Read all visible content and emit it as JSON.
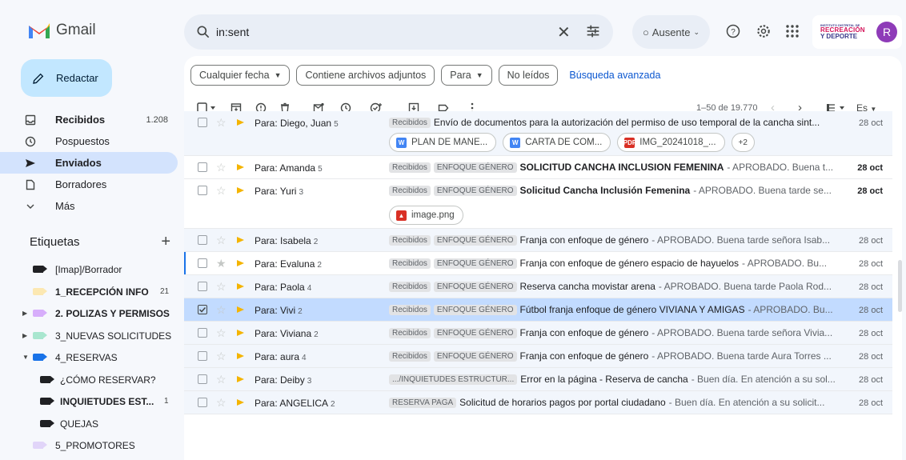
{
  "app": {
    "name": "Gmail"
  },
  "search": {
    "value": "in:sent",
    "clear_label": "✕"
  },
  "header": {
    "status_label": "Ausente",
    "org": {
      "line1": "INSTITUTO DISTRITAL DE",
      "line2": "RECREACIÓN",
      "line3": "Y DEPORTE"
    },
    "avatar_letter": "R"
  },
  "compose_label": "Redactar",
  "nav": [
    {
      "label": "Recibidos",
      "count": "1.208",
      "bold": true,
      "icon": "inbox-icon"
    },
    {
      "label": "Pospuestos",
      "count": "",
      "bold": false,
      "icon": "snooze-icon"
    },
    {
      "label": "Enviados",
      "count": "",
      "bold": true,
      "icon": "send-icon"
    },
    {
      "label": "Borradores",
      "count": "",
      "bold": false,
      "icon": "draft-icon"
    },
    {
      "label": "Más",
      "count": "",
      "bold": false,
      "icon": "chevron-down-icon"
    }
  ],
  "labels_title": "Etiquetas",
  "labels": [
    {
      "label": "[Imap]/Borrador",
      "count": "",
      "color": "#202124",
      "bold": false,
      "sub": false,
      "tri": ""
    },
    {
      "label": "1_RECEPCIÓN INFO",
      "count": "21",
      "color": "#fce8b2",
      "bold": true,
      "sub": false,
      "tri": ""
    },
    {
      "label": "2. POLIZAS Y PERMISOS",
      "count": "",
      "color": "#d7aefb",
      "bold": true,
      "sub": false,
      "tri": "▶"
    },
    {
      "label": "3_NUEVAS SOLICITUDES",
      "count": "",
      "color": "#a8e6cf",
      "bold": false,
      "sub": false,
      "tri": "▶"
    },
    {
      "label": "4_RESERVAS",
      "count": "",
      "color": "#1a73e8",
      "bold": false,
      "sub": false,
      "tri": "▼"
    },
    {
      "label": "¿CÓMO RESERVAR?",
      "count": "",
      "color": "#202124",
      "bold": false,
      "sub": true,
      "tri": ""
    },
    {
      "label": "INQUIETUDES EST...",
      "count": "1",
      "color": "#202124",
      "bold": true,
      "sub": true,
      "tri": ""
    },
    {
      "label": "QUEJAS",
      "count": "",
      "color": "#202124",
      "bold": false,
      "sub": true,
      "tri": ""
    },
    {
      "label": "5_PROMOTORES",
      "count": "",
      "color": "#e1d5f9",
      "bold": false,
      "sub": false,
      "tri": ""
    }
  ],
  "filters": {
    "date": "Cualquier fecha",
    "attachments": "Contiene archivos adjuntos",
    "to": "Para",
    "unread": "No leídos",
    "advanced": "Búsqueda avanzada"
  },
  "pagination": {
    "range": "1–50 de 19.770",
    "lang": "Es"
  },
  "emails": [
    {
      "sender": "Para: Diego, Juan",
      "count": "5",
      "badges": [
        "Recibidos"
      ],
      "subject": "Envío de documentos para la autorización del permiso de uso temporal de la cancha sint...",
      "snippet": "",
      "date": "28 oct",
      "unread": false,
      "selected": false,
      "focused": false,
      "bold_subject": false,
      "attachments": [
        {
          "name": "PLAN DE MANE...",
          "type": "W",
          "color": "#4285f4"
        },
        {
          "name": "CARTA DE COM...",
          "type": "W",
          "color": "#4285f4"
        },
        {
          "name": "IMG_20241018_...",
          "type": "PDF",
          "color": "#d93025"
        }
      ],
      "more": "+2"
    },
    {
      "sender": "Para: Amanda",
      "count": "5",
      "badges": [
        "Recibidos",
        "ENFOQUE GÉNERO"
      ],
      "subject": "SOLICITUD CANCHA INCLUSION FEMENINA",
      "snippet": " - APROBADO. Buena t...",
      "date": "28 oct",
      "unread": true,
      "selected": false,
      "focused": false,
      "bold_subject": true,
      "attachments": [],
      "more": ""
    },
    {
      "sender": "Para: Yuri",
      "count": "3",
      "badges": [
        "Recibidos",
        "ENFOQUE GÉNERO"
      ],
      "subject": "Solicitud Cancha Inclusión Femenina",
      "snippet": " - APROBADO. Buena tarde se...",
      "date": "28 oct",
      "unread": true,
      "selected": false,
      "focused": false,
      "bold_subject": true,
      "attachments": [
        {
          "name": "image.png",
          "type": "IMG",
          "color": "#d93025"
        }
      ],
      "more": ""
    },
    {
      "sender": "Para: Isabela",
      "count": "2",
      "badges": [
        "Recibidos",
        "ENFOQUE GÉNERO"
      ],
      "subject": "Franja con enfoque de género",
      "snippet": " - APROBADO. Buena tarde señora Isab...",
      "date": "28 oct",
      "unread": false,
      "selected": false,
      "focused": false,
      "bold_subject": false,
      "attachments": [],
      "more": ""
    },
    {
      "sender": "Para: Evaluna",
      "count": "2",
      "badges": [
        "Recibidos",
        "ENFOQUE GÉNERO"
      ],
      "subject": "Franja con enfoque de género espacio de hayuelos",
      "snippet": " - APROBADO. Bu...",
      "date": "28 oct",
      "unread": false,
      "selected": false,
      "focused": true,
      "bold_subject": false,
      "attachments": [],
      "more": ""
    },
    {
      "sender": "Para: Paola",
      "count": "4",
      "badges": [
        "Recibidos",
        "ENFOQUE GÉNERO"
      ],
      "subject": "Reserva cancha movistar arena",
      "snippet": " - APROBADO. Buena tarde Paola Rod...",
      "date": "28 oct",
      "unread": false,
      "selected": false,
      "focused": false,
      "bold_subject": false,
      "attachments": [],
      "more": ""
    },
    {
      "sender": "Para: Vivi",
      "count": "2",
      "badges": [
        "Recibidos",
        "ENFOQUE GÉNERO"
      ],
      "subject": "Fútbol franja enfoque de género VIVIANA Y AMIGAS",
      "snippet": " - APROBADO. Bu...",
      "date": "28 oct",
      "unread": false,
      "selected": true,
      "focused": false,
      "bold_subject": false,
      "attachments": [],
      "more": ""
    },
    {
      "sender": "Para: Viviana",
      "count": "2",
      "badges": [
        "Recibidos",
        "ENFOQUE GÉNERO"
      ],
      "subject": "Franja con enfoque de género",
      "snippet": " - APROBADO. Buena tarde señora Vivia...",
      "date": "28 oct",
      "unread": false,
      "selected": false,
      "focused": false,
      "bold_subject": false,
      "attachments": [],
      "more": ""
    },
    {
      "sender": "Para: aura",
      "count": "4",
      "badges": [
        "Recibidos",
        "ENFOQUE GÉNERO"
      ],
      "subject": "Franja con enfoque de género",
      "snippet": " - APROBADO. Buena tarde Aura Torres ...",
      "date": "28 oct",
      "unread": false,
      "selected": false,
      "focused": false,
      "bold_subject": false,
      "attachments": [],
      "more": ""
    },
    {
      "sender": "Para: Deiby",
      "count": "3",
      "badges": [
        ".../INQUIETUDES ESTRUCTUR..."
      ],
      "subject": "Error en la página - Reserva de cancha",
      "snippet": " - Buen día. En atención a su sol...",
      "date": "28 oct",
      "unread": false,
      "selected": false,
      "focused": false,
      "bold_subject": false,
      "attachments": [],
      "more": ""
    },
    {
      "sender": "Para: ANGELICA",
      "count": "2",
      "badges": [
        "RESERVA PAGA"
      ],
      "subject": "Solicitud de horarios pagos por portal ciudadano",
      "snippet": " - Buen día. En atención a su solicit...",
      "date": "28 oct",
      "unread": false,
      "selected": false,
      "focused": false,
      "bold_subject": false,
      "attachments": [],
      "more": ""
    }
  ]
}
